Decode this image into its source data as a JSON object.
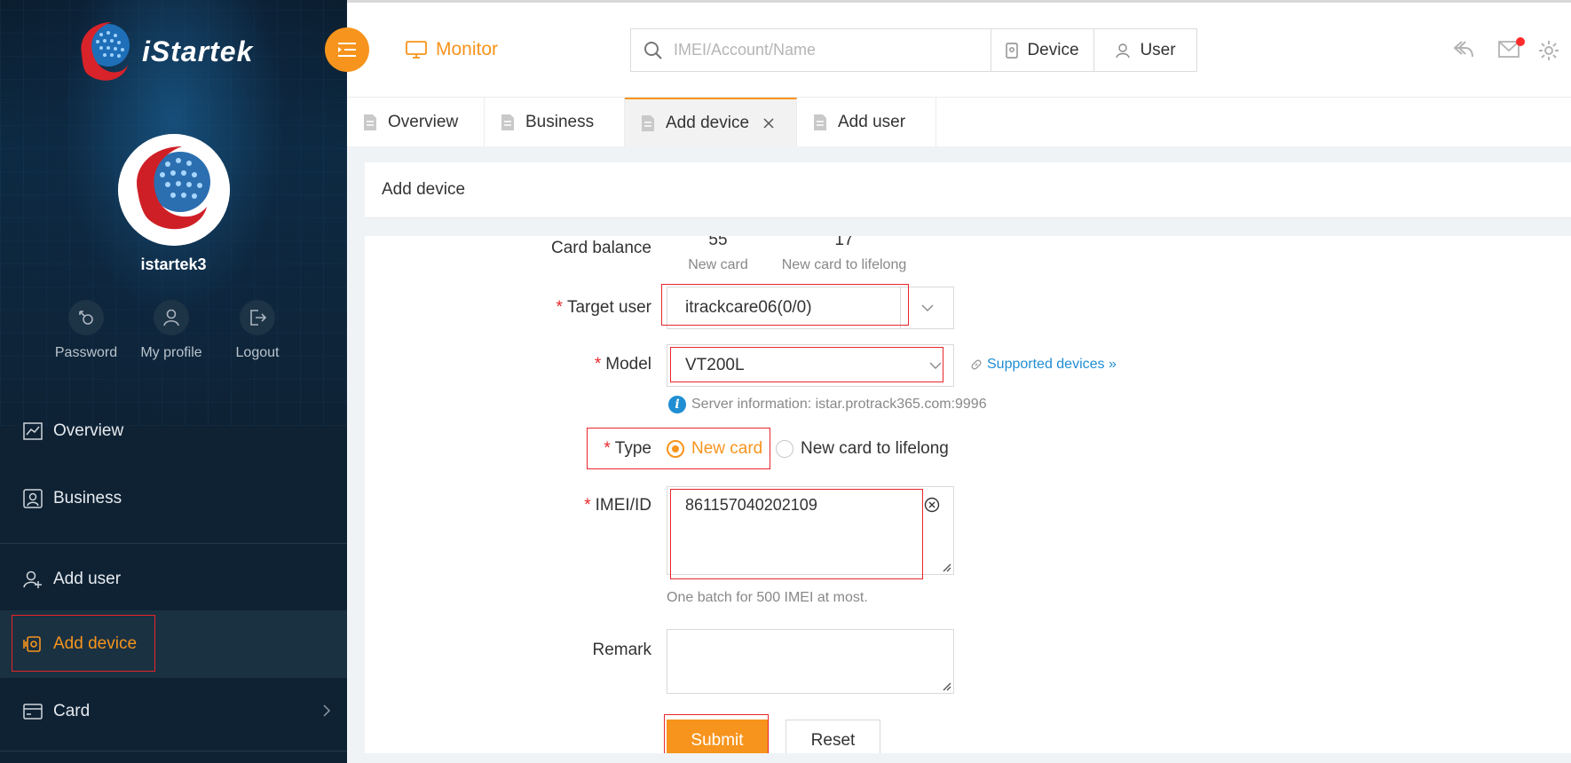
{
  "brand": {
    "name": "iStartek"
  },
  "user": {
    "name": "istartek3"
  },
  "quick_actions": [
    {
      "label": "Password",
      "icon": "password-icon"
    },
    {
      "label": "My profile",
      "icon": "profile-icon"
    },
    {
      "label": "Logout",
      "icon": "logout-icon"
    }
  ],
  "nav": [
    {
      "label": "Overview",
      "icon": "chart-icon"
    },
    {
      "label": "Business",
      "icon": "business-icon"
    },
    {
      "label": "Add user",
      "icon": "add-user-icon"
    },
    {
      "label": "Add device",
      "icon": "add-device-icon",
      "active": true
    },
    {
      "label": "Card",
      "icon": "card-icon"
    }
  ],
  "header": {
    "module": "Monitor",
    "search_placeholder": "IMEI/Account/Name",
    "search_scopes": [
      "Device",
      "User"
    ],
    "has_unread_mail": true
  },
  "tabs": [
    {
      "label": "Overview"
    },
    {
      "label": "Business"
    },
    {
      "label": "Add device",
      "active": true,
      "closable": true
    },
    {
      "label": "Add user"
    }
  ],
  "panel": {
    "title": "Add device"
  },
  "form": {
    "card_balance": {
      "label": "Card balance",
      "items": [
        {
          "value": "55",
          "caption": "New card"
        },
        {
          "value": "17",
          "caption": "New card to lifelong"
        }
      ]
    },
    "target_user": {
      "label": "Target user",
      "value": "itrackcare06(0/0)"
    },
    "model": {
      "label": "Model",
      "value": "VT200L",
      "link": "Supported devices »",
      "info": "Server information: istar.protrack365.com:9996"
    },
    "type": {
      "label": "Type",
      "options": [
        "New card",
        "New card to lifelong"
      ],
      "selected": "New card"
    },
    "imei": {
      "label": "IMEI/ID",
      "value": "861157040202109",
      "hint": "One batch for 500 IMEI at most."
    },
    "remark": {
      "label": "Remark",
      "value": ""
    },
    "submit_label": "Submit",
    "reset_label": "Reset"
  },
  "colors": {
    "accent": "#f7941d",
    "sidebar": "#0f2233",
    "highlight": "#e8262a",
    "link": "#1f8ed3"
  }
}
